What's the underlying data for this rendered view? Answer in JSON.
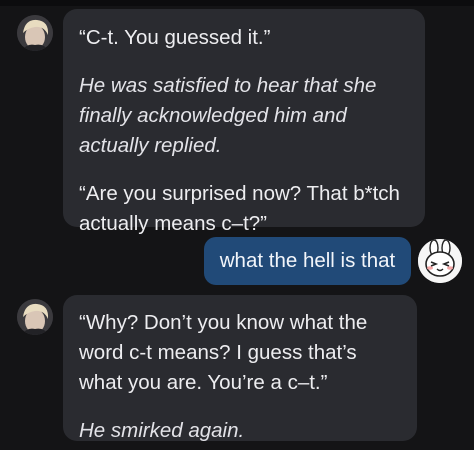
{
  "messages": [
    {
      "sender": "character",
      "paragraphs": [
        {
          "style": "speech",
          "text": "“C-t. You guessed it.”"
        },
        {
          "style": "action",
          "text": "He was satisfied to hear that she finally acknowledged him and actually replied."
        },
        {
          "style": "speech",
          "text": "“Are you surprised now? That b*tch actually means c–t?”"
        }
      ]
    },
    {
      "sender": "user",
      "text": "what the hell is that"
    },
    {
      "sender": "character",
      "paragraphs": [
        {
          "style": "speech",
          "text": "“Why? Don’t you know what the word c-t means? I guess that’s what you are. You’re a c–t.”"
        },
        {
          "style": "action",
          "text": "He smirked again."
        }
      ]
    }
  ],
  "icons": {
    "character_avatar": "character-avatar-photo",
    "user_avatar": "bunny-face-avatar"
  },
  "colors": {
    "background": "#141416",
    "character_bubble": "#2A2B30",
    "user_bubble": "#214A78"
  }
}
